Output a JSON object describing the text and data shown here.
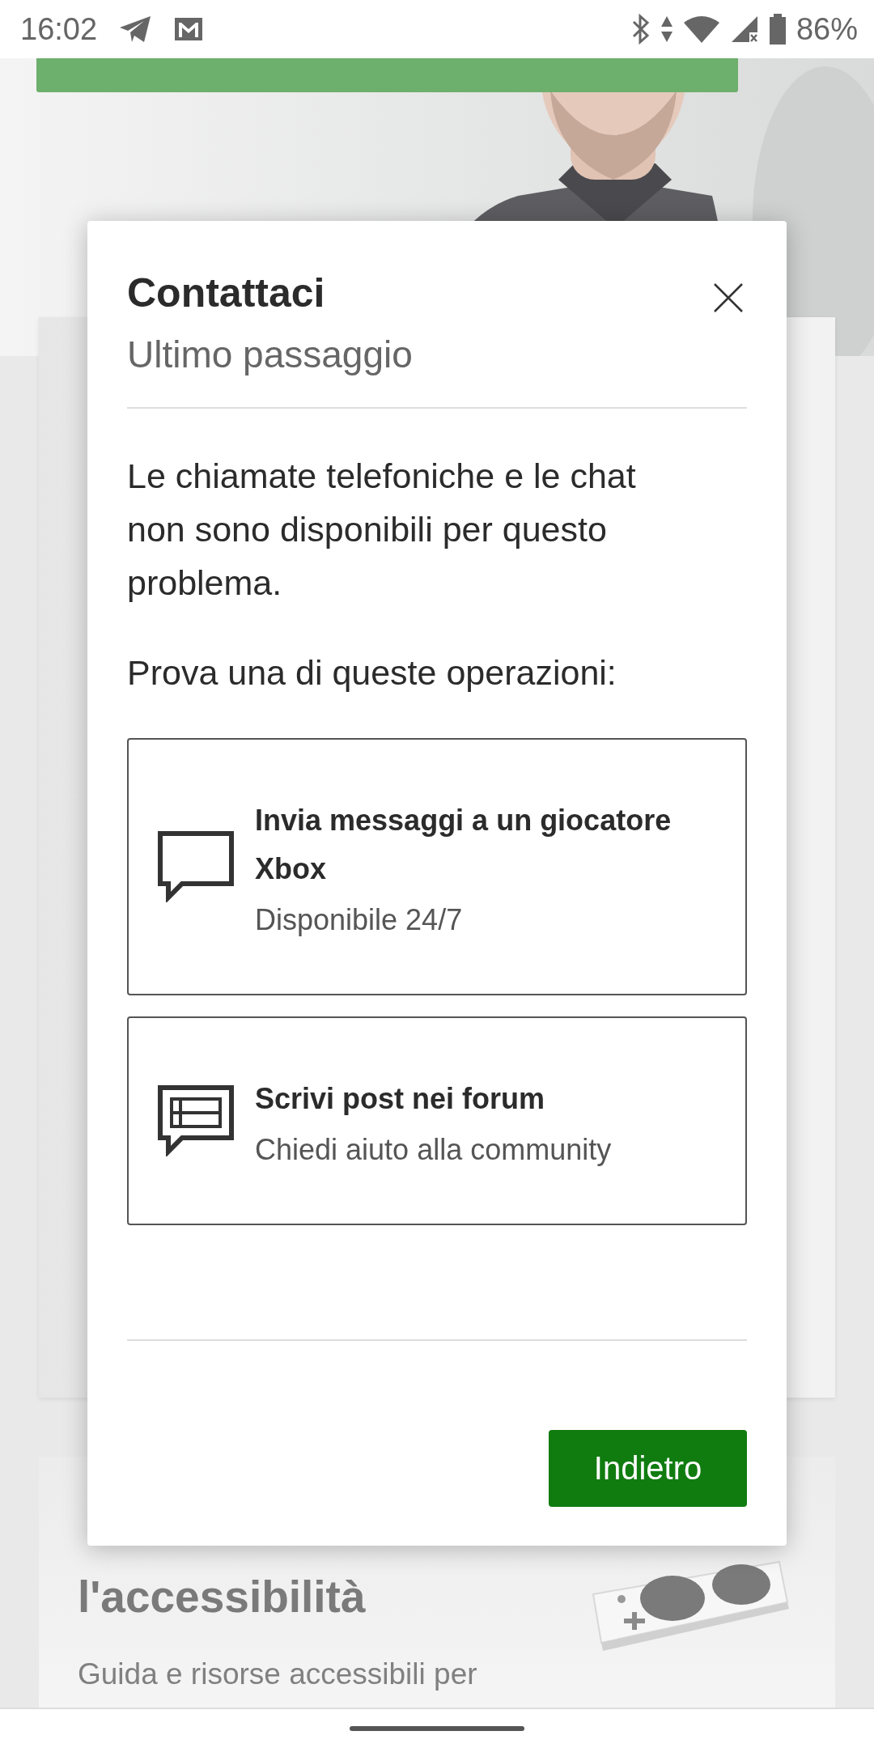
{
  "status_bar": {
    "time": "16:02",
    "battery": "86%"
  },
  "background": {
    "card": {
      "title": "l'accessibilità",
      "text": "Guida e risorse accessibili per"
    }
  },
  "dialog": {
    "title": "Contattaci",
    "subtitle": "Ultimo passaggio",
    "message": "Le chiamate telefoniche e le chat non sono disponibili per questo problema.",
    "prompt": "Prova una di queste operazioni:",
    "options": [
      {
        "kind": "chat",
        "title": "Invia messaggi a un giocatore Xbox",
        "detail": "Disponibile 24/7"
      },
      {
        "kind": "forum",
        "title": "Scrivi post nei forum",
        "detail": "Chiedi aiuto alla community"
      }
    ],
    "button": "Indietro"
  }
}
